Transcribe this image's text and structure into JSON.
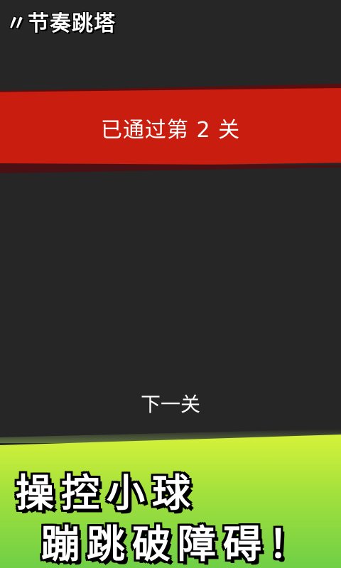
{
  "header": {
    "title": "节奏跳塔",
    "title_mark": "〃"
  },
  "banner": {
    "text": "已通过第 2 关"
  },
  "actions": {
    "next_level": "下一关"
  },
  "promo": {
    "line1": "操控小球",
    "line2": "蹦跳破障碍！"
  },
  "colors": {
    "background": "#262626",
    "banner": "#c81d0f",
    "promo_top": "#d6f23a",
    "promo_bottom": "#6fcf46"
  }
}
